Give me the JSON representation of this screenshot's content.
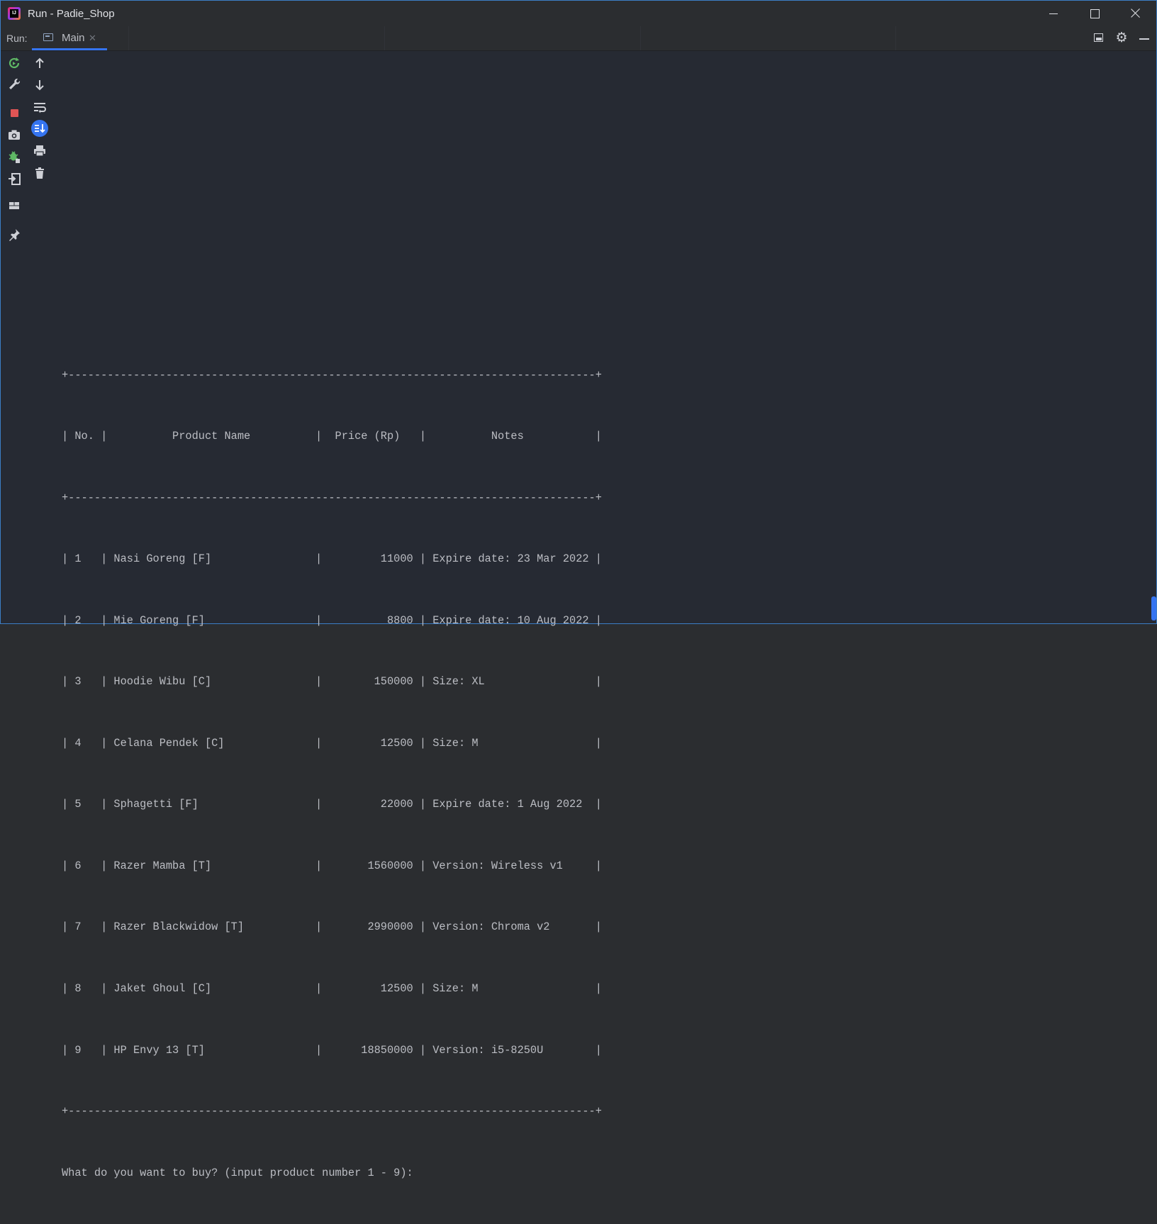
{
  "window": {
    "title": "Run - Padie_Shop",
    "app_icon_text": "IJ",
    "border_color": "#3c7ec6",
    "background": "#262a33",
    "controls": {
      "minimize": "minimize-icon",
      "maximize": "maximize-icon",
      "close": "close-icon"
    }
  },
  "tabbar": {
    "run_label": "Run:",
    "tab": {
      "label": "Main",
      "close": "✕",
      "icon": "console-window-icon",
      "accent": "#3574f0"
    },
    "right_tools": [
      "layout-icon",
      "gear-icon",
      "hide-icon"
    ]
  },
  "toolbar_left": [
    "rerun-icon",
    "wrench-icon",
    "stop-icon",
    "camera-icon",
    "debug-bug-icon",
    "restore-layout-icon",
    "layout-grid-icon",
    "pin-icon"
  ],
  "toolbar_right": [
    "up-arrow-icon",
    "down-arrow-icon",
    "soft-wrap-icon",
    "scroll-to-end-icon",
    "print-icon",
    "trash-icon"
  ],
  "console": {
    "border_line": "+---------------------------------------------------------------------------------+",
    "header_line": "| No. |          Product Name          |  Price (Rp)   |          Notes           |",
    "rows": [
      "| 1   | Nasi Goreng [F]                |         11000 | Expire date: 23 Mar 2022 |",
      "| 2   | Mie Goreng [F]                 |          8800 | Expire date: 10 Aug 2022 |",
      "| 3   | Hoodie Wibu [C]                |        150000 | Size: XL                 |",
      "| 4   | Celana Pendek [C]              |         12500 | Size: M                  |",
      "| 5   | Sphagetti [F]                  |         22000 | Expire date: 1 Aug 2022  |",
      "| 6   | Razer Mamba [T]                |       1560000 | Version: Wireless v1     |",
      "| 7   | Razer Blackwidow [T]           |       2990000 | Version: Chroma v2       |",
      "| 8   | Jaket Ghoul [C]                |         12500 | Size: M                  |",
      "| 9   | HP Envy 13 [T]                 |      18850000 | Version: i5-8250U        |"
    ],
    "prompt": "What do you want to buy? (input product number 1 - 9):"
  }
}
